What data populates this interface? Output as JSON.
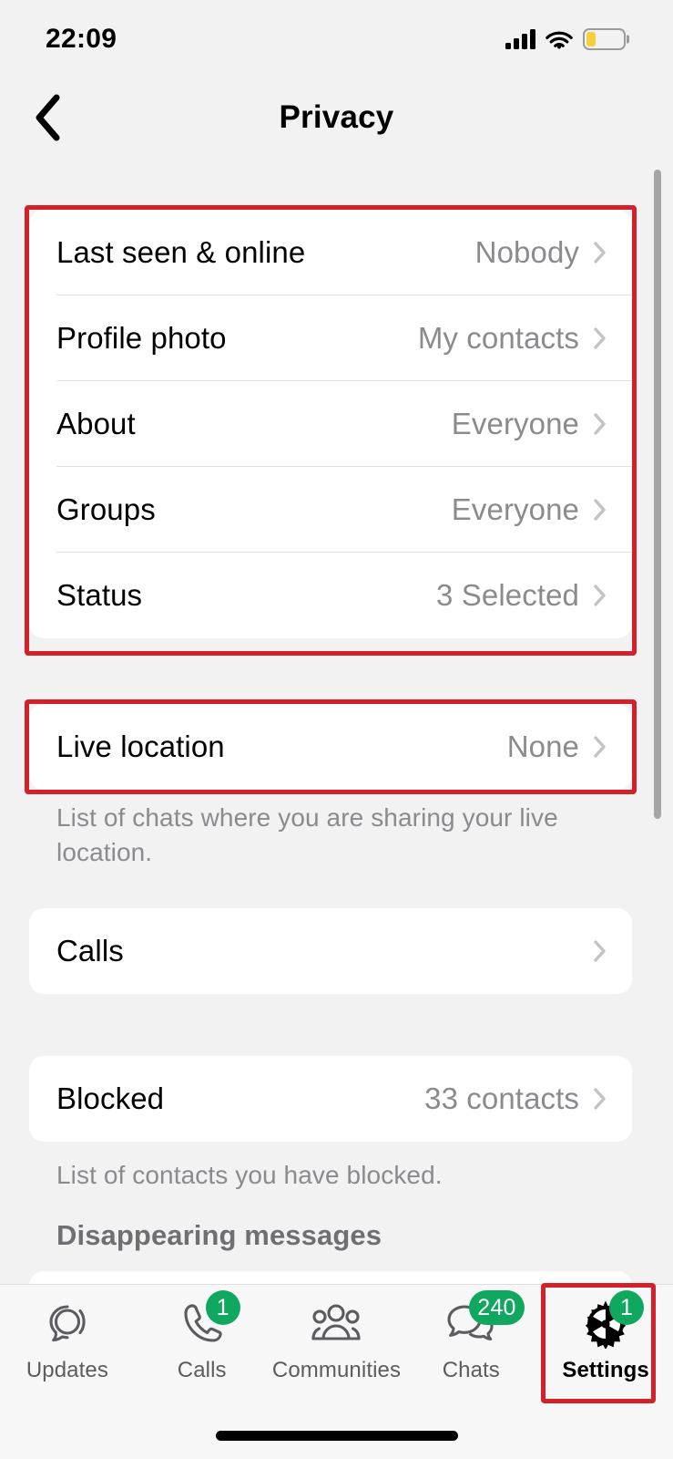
{
  "status_bar": {
    "time": "22:09",
    "signal_icon": "cellular-signal-icon",
    "wifi_icon": "wifi-icon",
    "battery_icon": "battery-low-power-icon",
    "battery_level_percent": 25,
    "battery_color": "#f5cf3d"
  },
  "header": {
    "title": "Privacy",
    "back_icon": "chevron-left-icon"
  },
  "privacy_group": {
    "rows": [
      {
        "label": "Last seen & online",
        "value": "Nobody"
      },
      {
        "label": "Profile photo",
        "value": "My contacts"
      },
      {
        "label": "About",
        "value": "Everyone"
      },
      {
        "label": "Groups",
        "value": "Everyone"
      },
      {
        "label": "Status",
        "value": "3 Selected"
      }
    ]
  },
  "live_location": {
    "row": {
      "label": "Live location",
      "value": "None"
    },
    "footnote": "List of chats where you are sharing your live location."
  },
  "calls": {
    "row": {
      "label": "Calls",
      "value": ""
    }
  },
  "blocked": {
    "row": {
      "label": "Blocked",
      "value": "33 contacts"
    },
    "footnote": "List of contacts you have blocked."
  },
  "disappearing_messages": {
    "section_title": "Disappearing messages"
  },
  "annotations": {
    "highlight_color": "#d32029",
    "regions": [
      "privacy-group-card",
      "live-location-card",
      "settings-tab"
    ]
  },
  "tabbar": {
    "tabs": [
      {
        "label": "Updates",
        "icon": "updates-status-icon",
        "badge": "",
        "active": false
      },
      {
        "label": "Calls",
        "icon": "phone-icon",
        "badge": "1",
        "active": false
      },
      {
        "label": "Communities",
        "icon": "communities-people-icon",
        "badge": "",
        "active": false
      },
      {
        "label": "Chats",
        "icon": "chat-bubbles-icon",
        "badge": "240",
        "active": false
      },
      {
        "label": "Settings",
        "icon": "gear-icon",
        "badge": "1",
        "active": true
      }
    ],
    "badge_color": "#10a75f"
  }
}
